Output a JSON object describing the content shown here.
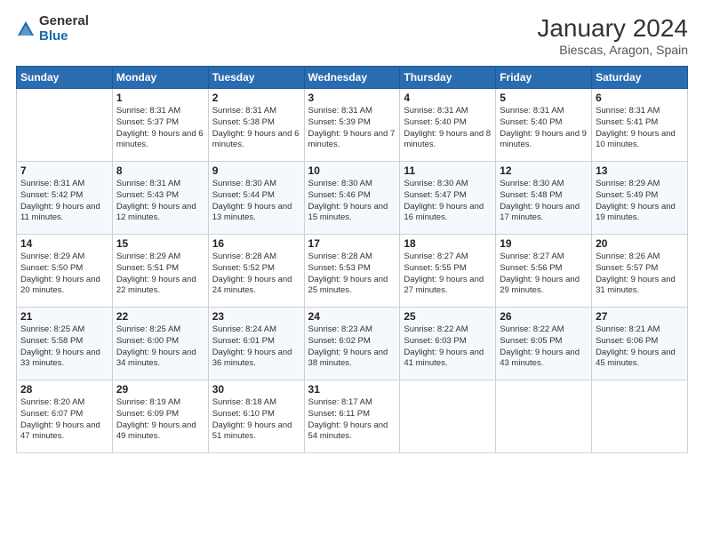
{
  "logo": {
    "general": "General",
    "blue": "Blue"
  },
  "header": {
    "title": "January 2024",
    "subtitle": "Biescas, Aragon, Spain"
  },
  "weekdays": [
    "Sunday",
    "Monday",
    "Tuesday",
    "Wednesday",
    "Thursday",
    "Friday",
    "Saturday"
  ],
  "weeks": [
    [
      {
        "num": "",
        "sunrise": "",
        "sunset": "",
        "daylight": ""
      },
      {
        "num": "1",
        "sunrise": "Sunrise: 8:31 AM",
        "sunset": "Sunset: 5:37 PM",
        "daylight": "Daylight: 9 hours and 6 minutes."
      },
      {
        "num": "2",
        "sunrise": "Sunrise: 8:31 AM",
        "sunset": "Sunset: 5:38 PM",
        "daylight": "Daylight: 9 hours and 6 minutes."
      },
      {
        "num": "3",
        "sunrise": "Sunrise: 8:31 AM",
        "sunset": "Sunset: 5:39 PM",
        "daylight": "Daylight: 9 hours and 7 minutes."
      },
      {
        "num": "4",
        "sunrise": "Sunrise: 8:31 AM",
        "sunset": "Sunset: 5:40 PM",
        "daylight": "Daylight: 9 hours and 8 minutes."
      },
      {
        "num": "5",
        "sunrise": "Sunrise: 8:31 AM",
        "sunset": "Sunset: 5:40 PM",
        "daylight": "Daylight: 9 hours and 9 minutes."
      },
      {
        "num": "6",
        "sunrise": "Sunrise: 8:31 AM",
        "sunset": "Sunset: 5:41 PM",
        "daylight": "Daylight: 9 hours and 10 minutes."
      }
    ],
    [
      {
        "num": "7",
        "sunrise": "Sunrise: 8:31 AM",
        "sunset": "Sunset: 5:42 PM",
        "daylight": "Daylight: 9 hours and 11 minutes."
      },
      {
        "num": "8",
        "sunrise": "Sunrise: 8:31 AM",
        "sunset": "Sunset: 5:43 PM",
        "daylight": "Daylight: 9 hours and 12 minutes."
      },
      {
        "num": "9",
        "sunrise": "Sunrise: 8:30 AM",
        "sunset": "Sunset: 5:44 PM",
        "daylight": "Daylight: 9 hours and 13 minutes."
      },
      {
        "num": "10",
        "sunrise": "Sunrise: 8:30 AM",
        "sunset": "Sunset: 5:46 PM",
        "daylight": "Daylight: 9 hours and 15 minutes."
      },
      {
        "num": "11",
        "sunrise": "Sunrise: 8:30 AM",
        "sunset": "Sunset: 5:47 PM",
        "daylight": "Daylight: 9 hours and 16 minutes."
      },
      {
        "num": "12",
        "sunrise": "Sunrise: 8:30 AM",
        "sunset": "Sunset: 5:48 PM",
        "daylight": "Daylight: 9 hours and 17 minutes."
      },
      {
        "num": "13",
        "sunrise": "Sunrise: 8:29 AM",
        "sunset": "Sunset: 5:49 PM",
        "daylight": "Daylight: 9 hours and 19 minutes."
      }
    ],
    [
      {
        "num": "14",
        "sunrise": "Sunrise: 8:29 AM",
        "sunset": "Sunset: 5:50 PM",
        "daylight": "Daylight: 9 hours and 20 minutes."
      },
      {
        "num": "15",
        "sunrise": "Sunrise: 8:29 AM",
        "sunset": "Sunset: 5:51 PM",
        "daylight": "Daylight: 9 hours and 22 minutes."
      },
      {
        "num": "16",
        "sunrise": "Sunrise: 8:28 AM",
        "sunset": "Sunset: 5:52 PM",
        "daylight": "Daylight: 9 hours and 24 minutes."
      },
      {
        "num": "17",
        "sunrise": "Sunrise: 8:28 AM",
        "sunset": "Sunset: 5:53 PM",
        "daylight": "Daylight: 9 hours and 25 minutes."
      },
      {
        "num": "18",
        "sunrise": "Sunrise: 8:27 AM",
        "sunset": "Sunset: 5:55 PM",
        "daylight": "Daylight: 9 hours and 27 minutes."
      },
      {
        "num": "19",
        "sunrise": "Sunrise: 8:27 AM",
        "sunset": "Sunset: 5:56 PM",
        "daylight": "Daylight: 9 hours and 29 minutes."
      },
      {
        "num": "20",
        "sunrise": "Sunrise: 8:26 AM",
        "sunset": "Sunset: 5:57 PM",
        "daylight": "Daylight: 9 hours and 31 minutes."
      }
    ],
    [
      {
        "num": "21",
        "sunrise": "Sunrise: 8:25 AM",
        "sunset": "Sunset: 5:58 PM",
        "daylight": "Daylight: 9 hours and 33 minutes."
      },
      {
        "num": "22",
        "sunrise": "Sunrise: 8:25 AM",
        "sunset": "Sunset: 6:00 PM",
        "daylight": "Daylight: 9 hours and 34 minutes."
      },
      {
        "num": "23",
        "sunrise": "Sunrise: 8:24 AM",
        "sunset": "Sunset: 6:01 PM",
        "daylight": "Daylight: 9 hours and 36 minutes."
      },
      {
        "num": "24",
        "sunrise": "Sunrise: 8:23 AM",
        "sunset": "Sunset: 6:02 PM",
        "daylight": "Daylight: 9 hours and 38 minutes."
      },
      {
        "num": "25",
        "sunrise": "Sunrise: 8:22 AM",
        "sunset": "Sunset: 6:03 PM",
        "daylight": "Daylight: 9 hours and 41 minutes."
      },
      {
        "num": "26",
        "sunrise": "Sunrise: 8:22 AM",
        "sunset": "Sunset: 6:05 PM",
        "daylight": "Daylight: 9 hours and 43 minutes."
      },
      {
        "num": "27",
        "sunrise": "Sunrise: 8:21 AM",
        "sunset": "Sunset: 6:06 PM",
        "daylight": "Daylight: 9 hours and 45 minutes."
      }
    ],
    [
      {
        "num": "28",
        "sunrise": "Sunrise: 8:20 AM",
        "sunset": "Sunset: 6:07 PM",
        "daylight": "Daylight: 9 hours and 47 minutes."
      },
      {
        "num": "29",
        "sunrise": "Sunrise: 8:19 AM",
        "sunset": "Sunset: 6:09 PM",
        "daylight": "Daylight: 9 hours and 49 minutes."
      },
      {
        "num": "30",
        "sunrise": "Sunrise: 8:18 AM",
        "sunset": "Sunset: 6:10 PM",
        "daylight": "Daylight: 9 hours and 51 minutes."
      },
      {
        "num": "31",
        "sunrise": "Sunrise: 8:17 AM",
        "sunset": "Sunset: 6:11 PM",
        "daylight": "Daylight: 9 hours and 54 minutes."
      },
      {
        "num": "",
        "sunrise": "",
        "sunset": "",
        "daylight": ""
      },
      {
        "num": "",
        "sunrise": "",
        "sunset": "",
        "daylight": ""
      },
      {
        "num": "",
        "sunrise": "",
        "sunset": "",
        "daylight": ""
      }
    ]
  ]
}
